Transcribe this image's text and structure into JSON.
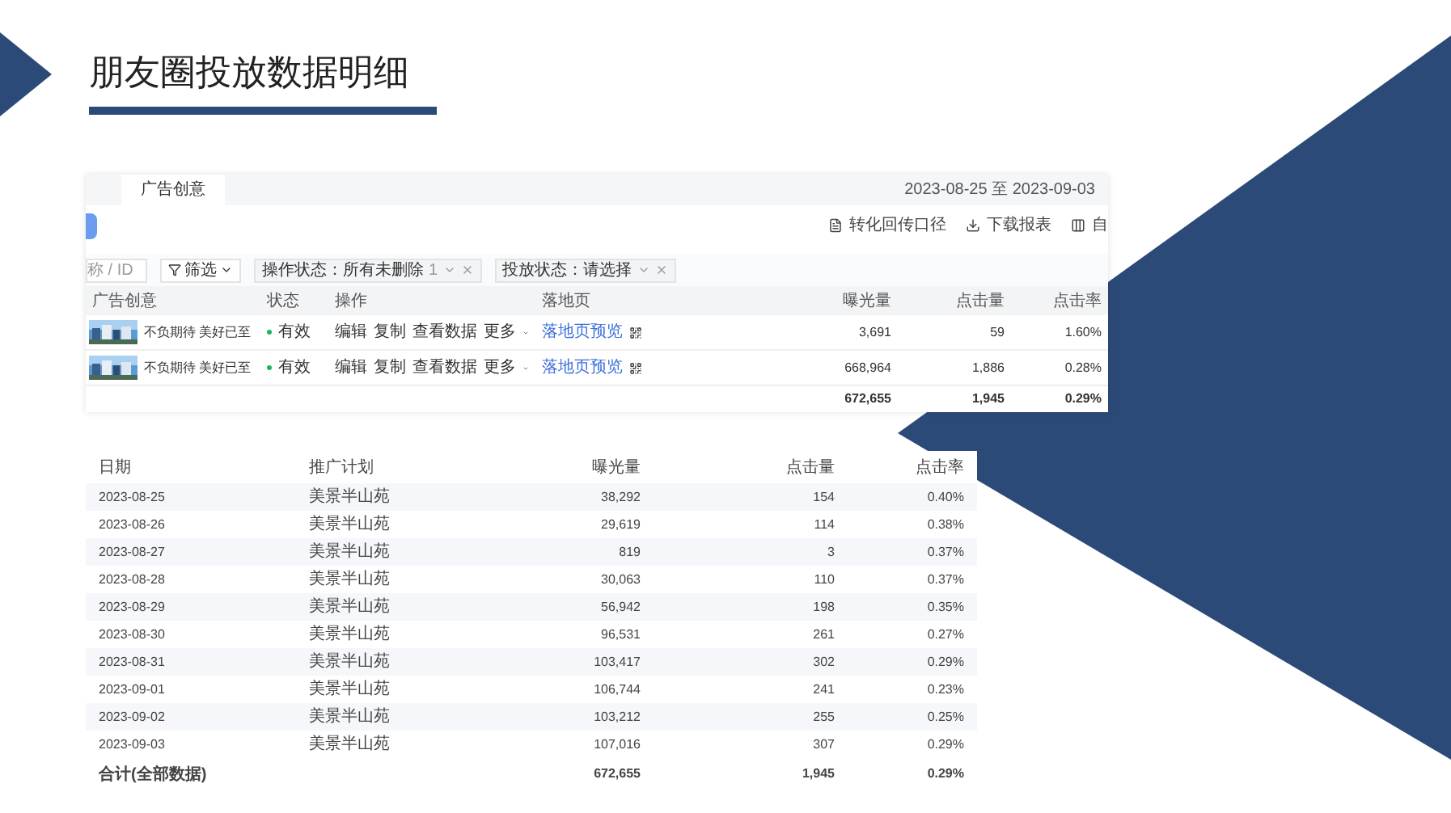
{
  "slide": {
    "title": "朋友圈投放数据明细"
  },
  "ad_report": {
    "tab": "广告创意",
    "date_range": "2023-08-25 至 2023-09-03",
    "toolbar": [
      "转化回传口径",
      "下载报表",
      "自"
    ],
    "search": {
      "placeholder": "称 / ID"
    },
    "filter_button": "筛选",
    "filter_chips": [
      {
        "label": "操作状态：所有未删除",
        "count": "1"
      },
      {
        "label": "投放状态：请选择"
      }
    ],
    "columns": [
      "广告创意",
      "状态",
      "操作",
      "落地页",
      "曝光量",
      "点击量",
      "点击率"
    ],
    "rows": [
      {
        "creative": "不负期待 美好已至",
        "status": "有效",
        "actions": [
          "编辑",
          "复制",
          "查看数据",
          "更多"
        ],
        "landing_page": "落地页预览",
        "impressions": "3,691",
        "clicks": "59",
        "ctr": "1.60%"
      },
      {
        "creative": "不负期待 美好已至",
        "status": "有效",
        "actions": [
          "编辑",
          "复制",
          "查看数据",
          "更多"
        ],
        "landing_page": "落地页预览",
        "impressions": "668,964",
        "clicks": "1,886",
        "ctr": "0.28%"
      }
    ],
    "totals": {
      "impressions": "672,655",
      "clicks": "1,945",
      "ctr": "0.29%"
    }
  },
  "daily_report": {
    "columns": [
      "日期",
      "推广计划",
      "曝光量",
      "点击量",
      "点击率"
    ],
    "rows": [
      {
        "date": "2023-08-25",
        "plan": "美景半山苑",
        "impressions": "38,292",
        "clicks": "154",
        "ctr": "0.40%"
      },
      {
        "date": "2023-08-26",
        "plan": "美景半山苑",
        "impressions": "29,619",
        "clicks": "114",
        "ctr": "0.38%"
      },
      {
        "date": "2023-08-27",
        "plan": "美景半山苑",
        "impressions": "819",
        "clicks": "3",
        "ctr": "0.37%"
      },
      {
        "date": "2023-08-28",
        "plan": "美景半山苑",
        "impressions": "30,063",
        "clicks": "110",
        "ctr": "0.37%"
      },
      {
        "date": "2023-08-29",
        "plan": "美景半山苑",
        "impressions": "56,942",
        "clicks": "198",
        "ctr": "0.35%"
      },
      {
        "date": "2023-08-30",
        "plan": "美景半山苑",
        "impressions": "96,531",
        "clicks": "261",
        "ctr": "0.27%"
      },
      {
        "date": "2023-08-31",
        "plan": "美景半山苑",
        "impressions": "103,417",
        "clicks": "302",
        "ctr": "0.29%"
      },
      {
        "date": "2023-09-01",
        "plan": "美景半山苑",
        "impressions": "106,744",
        "clicks": "241",
        "ctr": "0.23%"
      },
      {
        "date": "2023-09-02",
        "plan": "美景半山苑",
        "impressions": "103,212",
        "clicks": "255",
        "ctr": "0.25%"
      },
      {
        "date": "2023-09-03",
        "plan": "美景半山苑",
        "impressions": "107,016",
        "clicks": "307",
        "ctr": "0.29%"
      }
    ],
    "totals": {
      "label": "合计(全部数据)",
      "impressions": "672,655",
      "clicks": "1,945",
      "ctr": "0.29%"
    }
  }
}
